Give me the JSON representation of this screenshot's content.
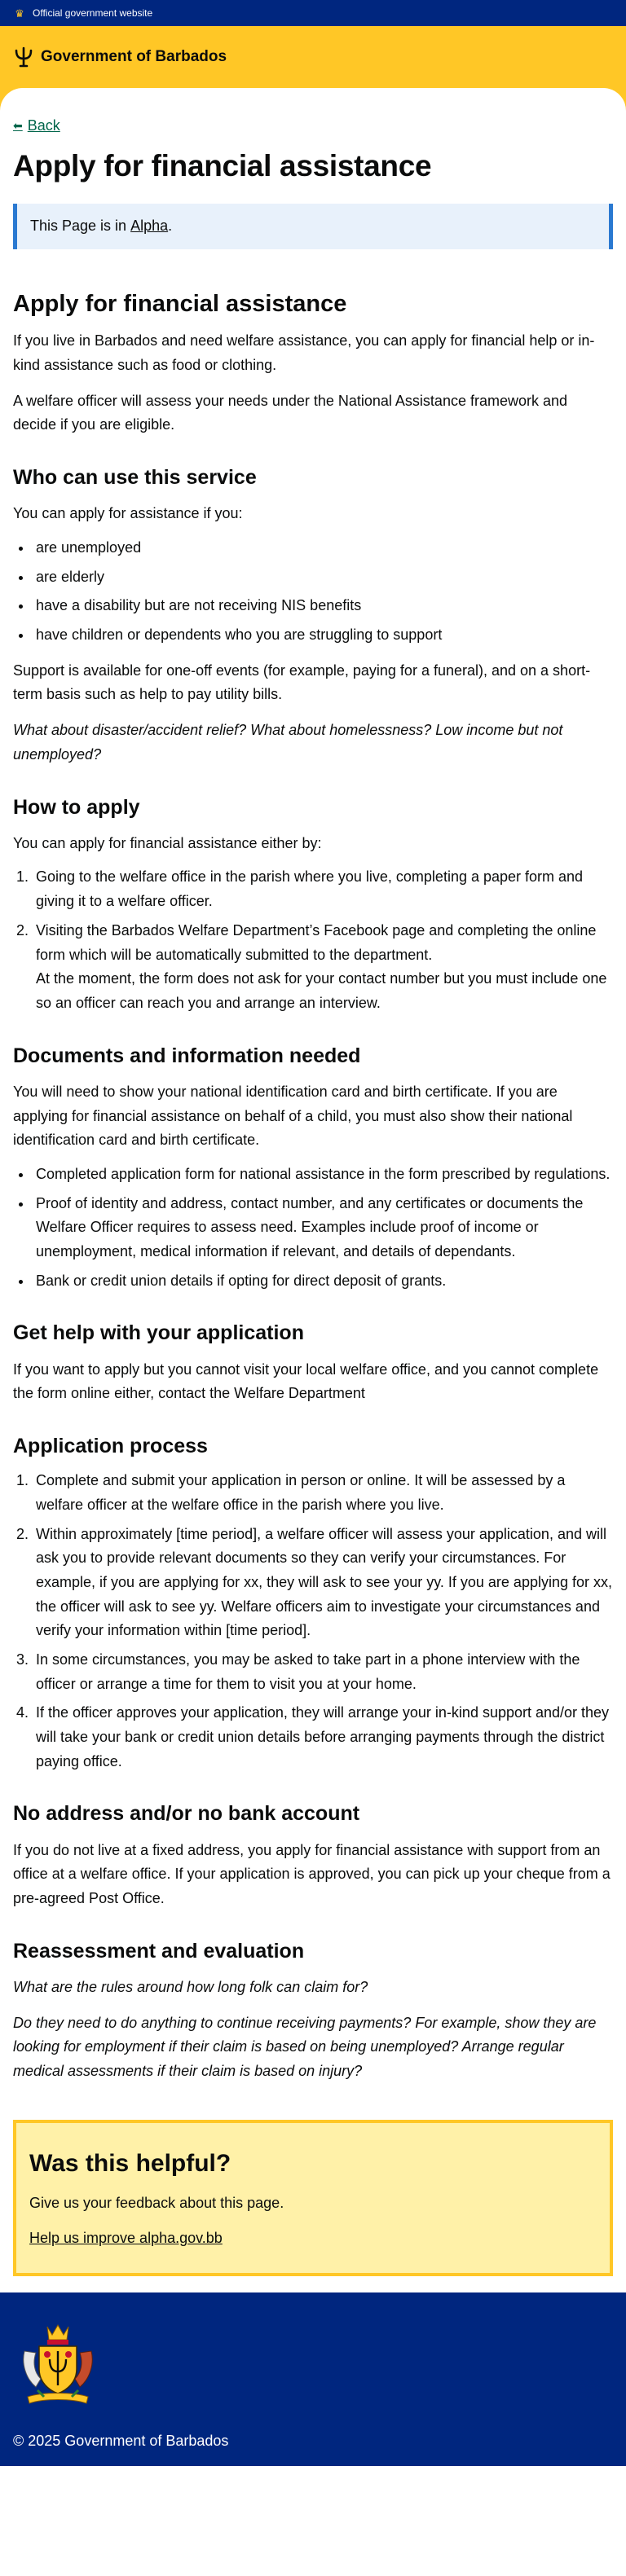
{
  "topbar": {
    "official_text": "Official government website"
  },
  "header": {
    "gov_name": "Government of Barbados"
  },
  "nav": {
    "back_label": "Back"
  },
  "page": {
    "title": "Apply for financial assistance",
    "alpha_prefix": "This Page is in ",
    "alpha_link": "Alpha",
    "alpha_suffix": "."
  },
  "content": {
    "intro_heading": "Apply for financial assistance",
    "intro_p1": "If you live in Barbados and need welfare assistance, you can apply for financial help or in-kind assistance such as food or clothing.",
    "intro_p2": "A welfare officer will assess your needs under the National Assistance framework and decide if you are eligible.",
    "who_heading": "Who can use this service",
    "who_intro": "You can apply for assistance if you:",
    "who_items": [
      "are unemployed",
      "are elderly",
      "have a disability but are not receiving NIS benefits",
      "have children or dependents who you are struggling to support"
    ],
    "who_support": "Support is available for one-off events (for example, paying for a funeral), and on a short-term basis such as help to pay utility bills.",
    "who_question": "What about disaster/accident relief? What about homelessness? Low income but not unemployed?",
    "how_heading": "How to apply",
    "how_intro": "You can apply for financial assistance either by:",
    "how_item1": "Going to the welfare office in the parish where you live, completing a paper form and giving it to a welfare officer.",
    "how_item2": "Visiting the Barbados Welfare Department’s Facebook page and completing the online form which will be automatically submitted to the department.",
    "how_item2_note": "At the moment, the form does not ask for your contact number but you must include one so an officer can reach you and arrange an interview.",
    "docs_heading": "Documents and information needed",
    "docs_intro": "You will need to show your national identification card and birth certificate. If you are applying for financial assistance on behalf of a child, you must also show their national identification card and birth certificate.",
    "docs_items": [
      "Completed application form for national assistance in the form prescribed by regulations.",
      "Proof of identity and address, contact number, and any certificates or documents the Welfare Officer requires to assess need. Examples include proof of income or unemployment, medical information if relevant, and details of dependants.",
      "Bank or credit union details if opting for direct deposit of grants."
    ],
    "help_heading": "Get help with your application",
    "help_text": "If you want to apply but you cannot visit your local welfare office, and you cannot complete the form online either, contact the Welfare Department",
    "process_heading": "Application process",
    "process_items": [
      "Complete and submit your application in person or online. It will be assessed by a welfare officer at the welfare office in the parish where you live.",
      "Within approximately [time period], a welfare officer will assess your application, and will ask you to provide relevant documents so they can verify your circumstances. For example, if you are applying for xx, they will ask to see your yy. If you are applying for xx, the officer will ask to see yy. Welfare officers aim to investigate your circumstances and verify your information within [time period].",
      "In some circumstances, you may be asked to take part in a phone interview with the officer or arrange a time for them to visit you at your home.",
      "If the officer approves your application, they will arrange your in-kind support and/or they will take your bank or credit union details before arranging payments through the district paying office."
    ],
    "noaddress_heading": "No address and/or no bank account",
    "noaddress_text": "If you do not live at a fixed address, you apply for financial assistance with support from an office at a welfare office. If your application is approved, you can pick up your cheque from a pre-agreed Post Office.",
    "reassess_heading": "Reassessment and evaluation",
    "reassess_q1": "What are the rules around how long folk can claim for?",
    "reassess_q2": "Do they need to do anything to continue receiving payments? For example, show they are looking for employment if their claim is based on being unemployed? Arrange regular medical assessments if their claim is based on injury?"
  },
  "feedback": {
    "heading": "Was this helpful?",
    "text": "Give us your feedback about this page.",
    "link": "Help us improve alpha.gov.bb"
  },
  "footer": {
    "copyright": "© 2025 Government of Barbados"
  },
  "colors": {
    "navy": "#00267f",
    "gold": "#ffc726",
    "link_green": "#00654a",
    "info_blue": "#2a79d1",
    "feedback_bg": "#fff1a8"
  },
  "icons": {
    "topbar": "coat-of-arms-icon",
    "header": "trident-icon",
    "back": "arrow-left-icon",
    "footer": "coat-of-arms-icon"
  }
}
